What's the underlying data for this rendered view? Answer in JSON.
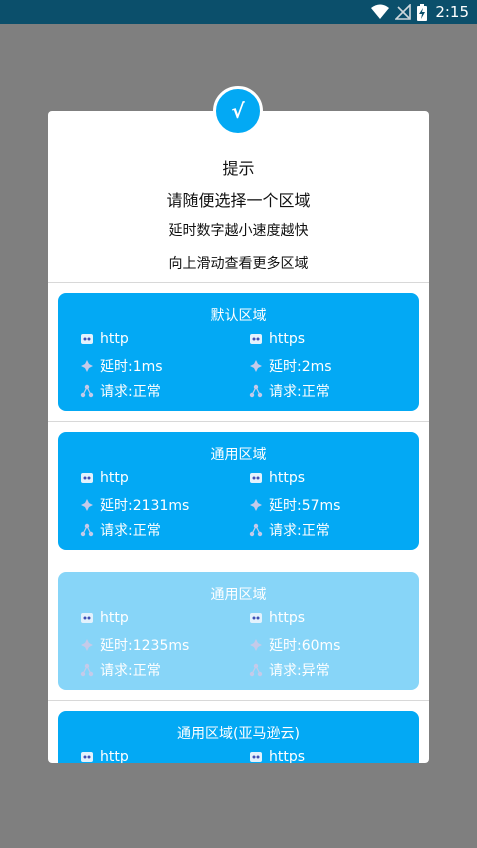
{
  "status_bar": {
    "time": "2:15"
  },
  "dialog": {
    "title": "提示",
    "line1": "请随便选择一个区域",
    "line2": "延时数字越小速度越快",
    "line3": "向上滑动查看更多区域",
    "regions": [
      {
        "name": "默认区域",
        "state": "normal",
        "http": "http",
        "https": "https",
        "delay_http": "延时:1ms",
        "delay_https": "延时:2ms",
        "req_http": "请求:正常",
        "req_https": "请求:正常"
      },
      {
        "name": "通用区域",
        "state": "normal",
        "http": "http",
        "https": "https",
        "delay_http": "延时:2131ms",
        "delay_https": "延时:57ms",
        "req_http": "请求:正常",
        "req_https": "请求:正常"
      },
      {
        "name": "通用区域",
        "state": "abnormal",
        "http": "http",
        "https": "https",
        "delay_http": "延时:1235ms",
        "delay_https": "延时:60ms",
        "req_http": "请求:正常",
        "req_https": "请求:异常"
      },
      {
        "name": "通用区域(亚马逊云)",
        "state": "normal",
        "http": "http",
        "https": "https"
      }
    ]
  }
}
